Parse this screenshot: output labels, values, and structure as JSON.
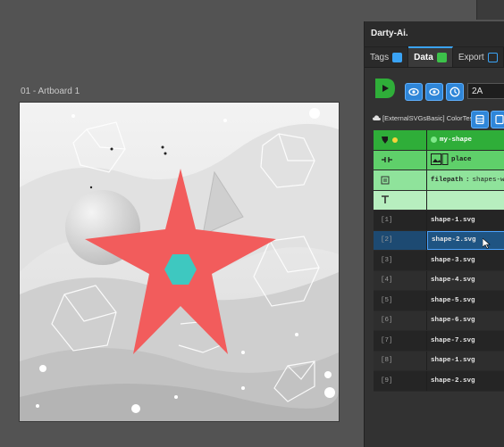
{
  "artboard": {
    "label": "01 - Artboard 1"
  },
  "panel": {
    "title": "Darty-Ai.",
    "tabs": [
      {
        "label": "Tags",
        "icon": "tag-icon"
      },
      {
        "label": "Data",
        "icon": "data-icon"
      },
      {
        "label": "Export",
        "icon": "export-icon"
      }
    ],
    "code_value": "2A",
    "datasource": "[ExternalSVGsBasic] ColorTest",
    "columns": {
      "name": "my-shape",
      "link_label": "place",
      "filepath_label": "filepath",
      "filepath_value": "shapes-with"
    },
    "rows": [
      {
        "index": "[1]",
        "value": "shape-1.svg"
      },
      {
        "index": "[2]",
        "value": "shape-2.svg"
      },
      {
        "index": "[3]",
        "value": "shape-3.svg"
      },
      {
        "index": "[4]",
        "value": "shape-4.svg"
      },
      {
        "index": "[5]",
        "value": "shape-5.svg"
      },
      {
        "index": "[6]",
        "value": "shape-6.svg"
      },
      {
        "index": "[7]",
        "value": "shape-7.svg"
      },
      {
        "index": "[8]",
        "value": "shape-1.svg"
      },
      {
        "index": "[9]",
        "value": "shape-2.svg"
      }
    ],
    "selected_row": "[2]"
  },
  "colors": {
    "accent_green": "#2fae39",
    "selection_blue": "#1d4a72",
    "star": "#f25c5c",
    "hexagon": "#3ec8c0"
  }
}
